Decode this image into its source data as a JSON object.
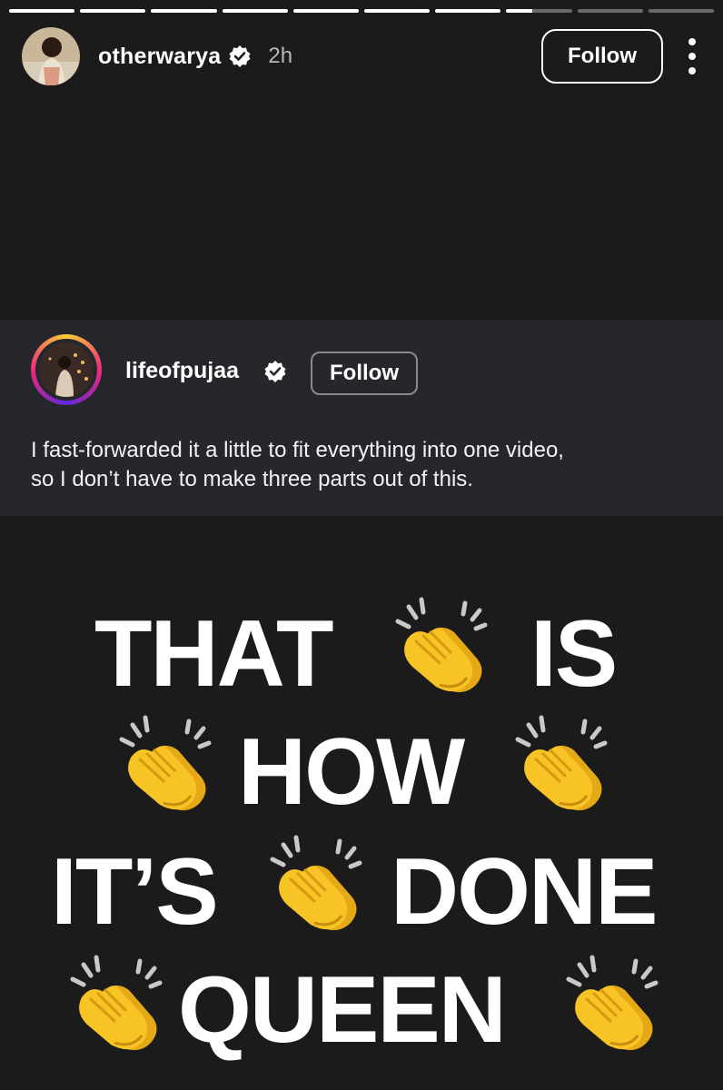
{
  "story": {
    "progress": [
      1,
      1,
      1,
      1,
      1,
      1,
      1,
      0.4,
      0,
      0
    ]
  },
  "header": {
    "username": "otherwarya",
    "time": "2h",
    "follow_label": "Follow",
    "verified_icon": "verified-badge-icon",
    "more_icon": "more-vertical-icon"
  },
  "shared_post": {
    "username": "lifeofpujaa",
    "follow_label": "Follow",
    "caption_line1": "I fast-forwarded it a little to fit everything into one video,",
    "caption_line2": "so I don’t have to make three parts out of this."
  },
  "overlay": {
    "word1": "THAT",
    "word2": "IS",
    "word3": "HOW",
    "word4": "IT’S",
    "word5": "DONE",
    "word6": "QUEEN",
    "emoji_icon": "clapping-hands-icon"
  },
  "colors": {
    "background": "#1b1b1b",
    "card": "#26272c",
    "clap_yellow": "#f7c325"
  }
}
